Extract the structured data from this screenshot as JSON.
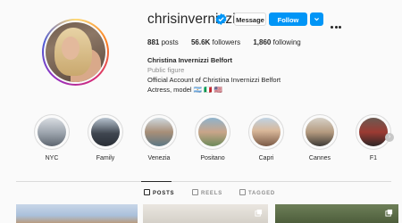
{
  "profile": {
    "username": "chrisinvernizzi",
    "verified": true,
    "buttons": {
      "message": "Message",
      "follow": "Follow"
    },
    "stats": {
      "posts_count": "881",
      "posts_label": "posts",
      "followers_count": "56.6K",
      "followers_label": "followers",
      "following_count": "1,860",
      "following_label": "following"
    },
    "full_name": "Christina Invernizzi Belfort",
    "category": "Public figure",
    "bio_line1": "Official Account of Christina Invernizzi Belfort",
    "bio_line2": "Actress, model 🇦🇷 🇮🇹 🇺🇸"
  },
  "highlights": [
    {
      "label": "NYC"
    },
    {
      "label": "Family"
    },
    {
      "label": "Venezia"
    },
    {
      "label": "Positano"
    },
    {
      "label": "Capri"
    },
    {
      "label": "Cannes"
    },
    {
      "label": "F1"
    }
  ],
  "tabs": [
    {
      "label": "POSTS",
      "active": true
    },
    {
      "label": "REELS",
      "active": false
    },
    {
      "label": "TAGGED",
      "active": false
    }
  ],
  "colors": {
    "accent": "#0095f6",
    "text": "#262626",
    "muted": "#8e8e8e",
    "border": "#dbdbdb"
  }
}
